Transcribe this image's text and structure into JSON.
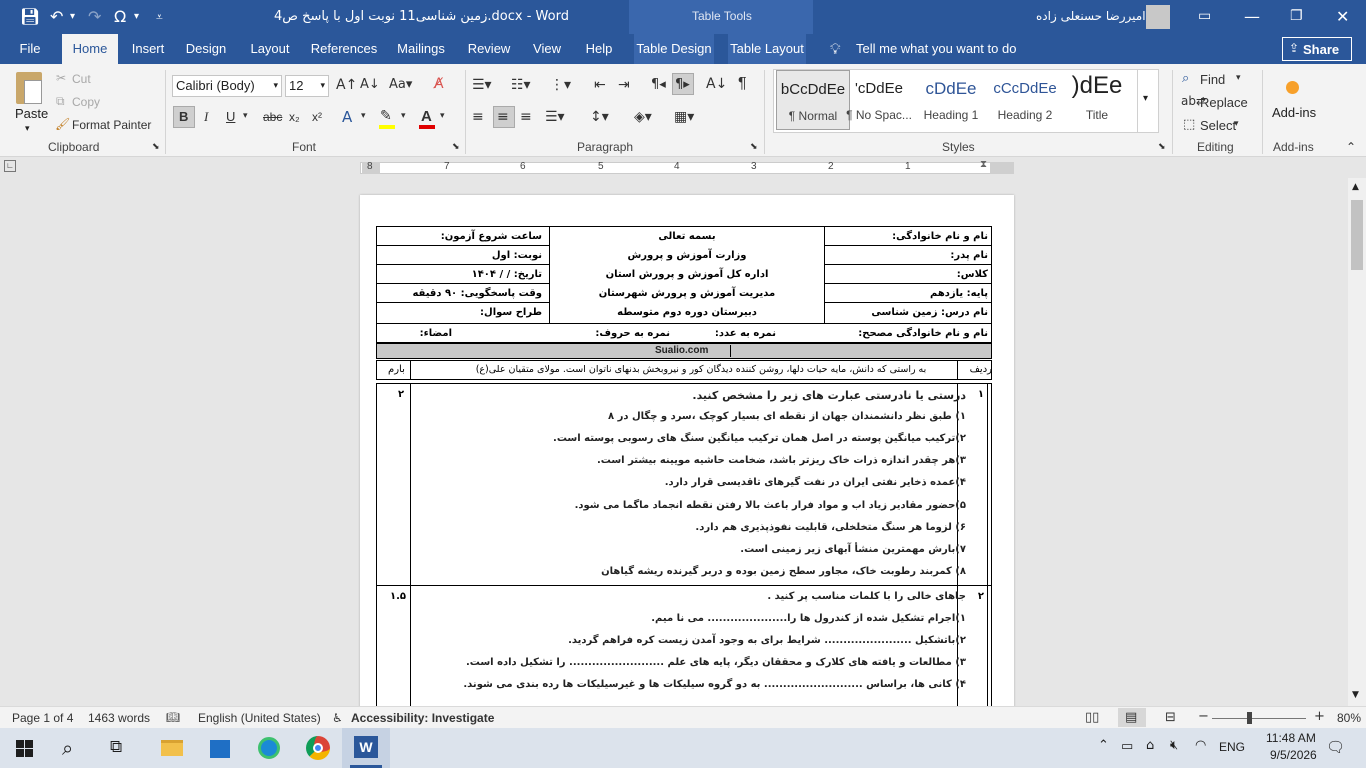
{
  "titlebar": {
    "document_title": "4زمین شناسی11 نوبت اول با پاسخ ص.docx  -  Word",
    "context_tab": "Table Tools",
    "user_name": "امیررضا حسنعلی زاده"
  },
  "tabs": [
    "File",
    "Home",
    "Insert",
    "Design",
    "Layout",
    "References",
    "Mailings",
    "Review",
    "View",
    "Help",
    "Table Design",
    "Table Layout"
  ],
  "tellme": "Tell me what you want to do",
  "share": "Share",
  "ribbon": {
    "clipboard": {
      "paste": "Paste",
      "cut": "Cut",
      "copy": "Copy",
      "format_painter": "Format Painter",
      "label": "Clipboard"
    },
    "font": {
      "font_name": "Calibri (Body)",
      "font_size": "12",
      "label": "Font"
    },
    "paragraph": {
      "label": "Paragraph"
    },
    "styles": {
      "label": "Styles",
      "items": [
        {
          "preview": "bCcDdEe",
          "name": "¶ Normal"
        },
        {
          "preview": "'cDdEe",
          "name": "¶ No Spac..."
        },
        {
          "preview": "cDdEe",
          "name": "Heading 1"
        },
        {
          "preview": "cCcDdEe",
          "name": "Heading 2"
        },
        {
          "preview": ")dEe",
          "name": "Title"
        }
      ]
    },
    "editing": {
      "find": "Find",
      "replace": "Replace",
      "select": "Select",
      "label": "Editing"
    },
    "addins": {
      "button": "Add-ins",
      "label": "Add-ins"
    }
  },
  "ruler_numbers": [
    "8",
    "7",
    "6",
    "5",
    "4",
    "3",
    "2",
    "1"
  ],
  "document": {
    "header_right": [
      "نام و نام خانوادگی:",
      "نام پدر:",
      "کلاس:",
      "پایه: یازدهم",
      "نام درس: زمین شناسی"
    ],
    "header_center": [
      "بسمه تعالی",
      "وزارت آموزش و پرورش",
      "اداره کل آموزش و پرورش استان",
      "مدیریت آموزش و پرورش شهرستان",
      "دبیرستان دوره دوم متوسطه"
    ],
    "header_left": [
      "ساعت شروع آزمون:",
      "نوبت: اول",
      "تاریخ:    /    /   ۱۴۰۴",
      "وقت پاسخگویی: ۹۰ دقیقه",
      "طراح سوال:"
    ],
    "grader_row": {
      "name": "نام و نام خانوادگی مصحح:",
      "score_num": "نمره به عدد:",
      "score_text": "نمره به حروف:",
      "sign": "امضاء:"
    },
    "site": "Sualio.com",
    "radif": "ردیف",
    "barem": "بارم",
    "quote": "به راستی که دانش، مایه حیات دلها، روشن کننده دیدگان کور و نیروبخش بدنهای ناتوان است. مولای متقیان علی(ع)",
    "questions": [
      {
        "num": "۱",
        "score": "۲",
        "title": "درستی یا نادرستی عبارت های زیر را مشخص کنید.",
        "items": [
          "۱) طبق نظر دانشمندان جهان از نقطه ای بسیار کوچک ،سرد و چگال در ۸",
          "۲)ترکیب میانگین پوسته در اصل همان ترکیب میانگین سنگ های رسوبی پوسته است.",
          "۳)هر چقدر اندازه ذرات خاک ریزتر باشد، ضخامت حاشیه مویینه بیشتر است.",
          "۴)عمده ذخایر نفتی ایران در نفت گیرهای تاقدیسی قرار دارد.",
          "۵)حضور مقادیر زیاد اب و مواد فرار باعث بالا رفتن نقطه انجماد ماگما می شود.",
          "۶) لزوما هر سنگ متخلخلی، قابلیت نفوذپذیری هم دارد.",
          "۷)بارش مهمترین منشأ آبهای زیر زمینی است.",
          "۸) کمربند رطوبت خاک، مجاور سطح زمین بوده و دربر گیرنده ریشه گیاهان"
        ]
      },
      {
        "num": "۲",
        "score": "۱.۵",
        "title": "جاهای خالی را با کلمات مناسب پر کنید .",
        "items": [
          "۱)اجرام تشکیل شده از کندرول ها را..................... می نا میم.",
          "۲)باتشکیل ....................... شرایط برای به وجود آمدن زیست کره فراهم گردید.",
          "۳) مطالعات و یافته های کلارک و محققان دیگر، پایه های علم ......................... را تشکیل داده  است.",
          "۴) کانی ها، براساس .......................... به دو گروه سیلیکات ها و غیرسیلیکات ها رده بندی می شوند."
        ]
      }
    ]
  },
  "status": {
    "page": "Page 1 of 4",
    "words": "1463 words",
    "language": "English (United States)",
    "accessibility": "Accessibility: Investigate",
    "zoom": "80%"
  },
  "taskbar": {
    "time": "11:48 AM",
    "date": "9/5/2026",
    "lang": "ENG"
  }
}
